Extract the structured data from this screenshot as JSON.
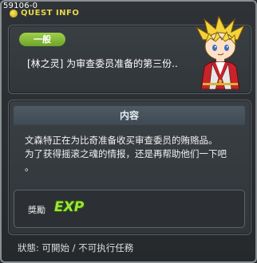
{
  "window": {
    "id_tag": "59106-0",
    "title": "QUEST INFO"
  },
  "quest": {
    "category": "一般",
    "name": "[林之灵] 为审查委员准备的第三份..",
    "portrait_icon": "npc-portrait-icon"
  },
  "content": {
    "header": "内容",
    "description": "文森特正在为比奇准备收买审查委员的贿赂品。\n为了获得摇滚之魂的情报，还是再帮助他们一下吧\n。"
  },
  "reward": {
    "label": "獎勵",
    "exp_label": "EXP"
  },
  "status": {
    "text": "狀態: 可開始 / 不可执行任務"
  },
  "colors": {
    "title": "#e8d84b",
    "badge": "#86bb38",
    "exp": "#9de53c"
  }
}
